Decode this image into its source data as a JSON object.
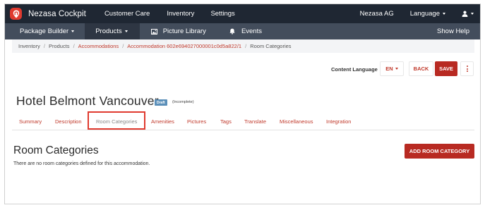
{
  "topbar": {
    "brand": "Nezasa Cockpit",
    "items": [
      "Customer Care",
      "Inventory",
      "Settings"
    ],
    "company": "Nezasa AG",
    "language_label": "Language"
  },
  "subbar": {
    "items": [
      "Package Builder",
      "Products",
      "Picture Library",
      "Events"
    ],
    "help": "Show Help"
  },
  "breadcrumb": {
    "items": [
      "Inventory",
      "Products",
      "Accommodations",
      "Accommodation 602e694027000001c0d5a822/1",
      "Room Categories"
    ]
  },
  "toolbar": {
    "content_language_label": "Content Language",
    "language_value": "EN",
    "back_label": "BACK",
    "save_label": "SAVE"
  },
  "header": {
    "title": "Hotel Belmont Vancouver",
    "badge": "Draft",
    "status": "(Incomplete)"
  },
  "tabs": [
    "Summary",
    "Description",
    "Room Categories",
    "Amenities",
    "Pictures",
    "Tags",
    "Translate",
    "Miscellaneous",
    "Integration"
  ],
  "active_tab": "Room Categories",
  "section": {
    "title": "Room Categories",
    "empty_text": "There are no room categories defined for this accommodation.",
    "add_button": "ADD ROOM CATEGORY"
  },
  "colors": {
    "topbar": "#1f2733",
    "subbar": "#434d5c",
    "accent": "#c0392b",
    "primary_button": "#b82a22",
    "badge": "#5b8fb9"
  }
}
